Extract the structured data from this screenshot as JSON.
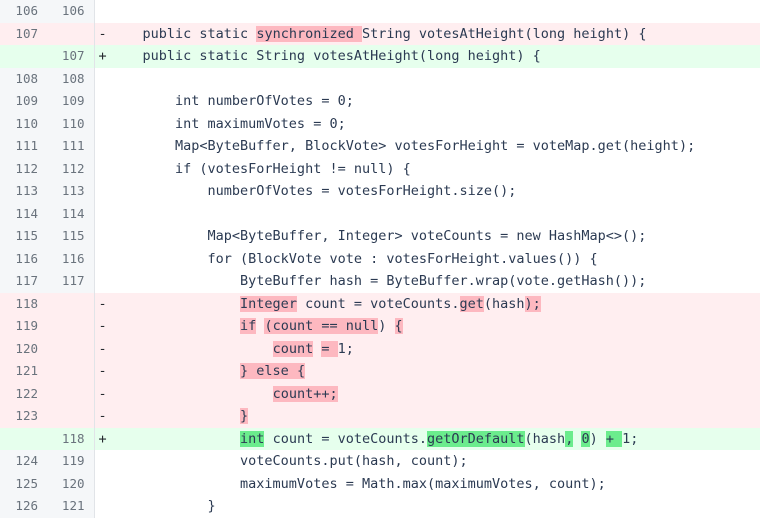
{
  "view": {
    "kind": "unified-code-diff",
    "language": "java",
    "colors": {
      "page_background": "#ffffff",
      "gutter_background": "#f5f7f9",
      "gutter_border": "#e1e4e8",
      "line_number_text": "#6a737d",
      "code_text": "#2b3a52",
      "deletion_line_background": "#ffeef0",
      "insertion_line_background": "#e6ffed",
      "deletion_word_highlight": "#fdb8c0",
      "insertion_word_highlight": "#6bec8d"
    },
    "markers": {
      "deletion": "-",
      "insertion": "+",
      "context": ""
    }
  },
  "rows": [
    {
      "type": "context",
      "old_line": "106",
      "new_line": "106",
      "marker": "",
      "segments": [
        {
          "text": "",
          "highlight": false
        }
      ]
    },
    {
      "type": "deletion",
      "old_line": "107",
      "new_line": "",
      "marker": "-",
      "segments": [
        {
          "text": "    public static ",
          "highlight": false
        },
        {
          "text": "synchronized ",
          "highlight": true
        },
        {
          "text": "String votesAtHeight(long height) {",
          "highlight": false
        }
      ]
    },
    {
      "type": "insertion",
      "old_line": "",
      "new_line": "107",
      "marker": "+",
      "segments": [
        {
          "text": "    public static String votesAtHeight(long height) {",
          "highlight": false
        }
      ]
    },
    {
      "type": "context",
      "old_line": "108",
      "new_line": "108",
      "marker": "",
      "segments": [
        {
          "text": "",
          "highlight": false
        }
      ]
    },
    {
      "type": "context",
      "old_line": "109",
      "new_line": "109",
      "marker": "",
      "segments": [
        {
          "text": "        int numberOfVotes = 0;",
          "highlight": false
        }
      ]
    },
    {
      "type": "context",
      "old_line": "110",
      "new_line": "110",
      "marker": "",
      "segments": [
        {
          "text": "        int maximumVotes = 0;",
          "highlight": false
        }
      ]
    },
    {
      "type": "context",
      "old_line": "111",
      "new_line": "111",
      "marker": "",
      "segments": [
        {
          "text": "        Map<ByteBuffer, BlockVote> votesForHeight = voteMap.get(height);",
          "highlight": false
        }
      ]
    },
    {
      "type": "context",
      "old_line": "112",
      "new_line": "112",
      "marker": "",
      "segments": [
        {
          "text": "        if (votesForHeight != null) {",
          "highlight": false
        }
      ]
    },
    {
      "type": "context",
      "old_line": "113",
      "new_line": "113",
      "marker": "",
      "segments": [
        {
          "text": "            numberOfVotes = votesForHeight.size();",
          "highlight": false
        }
      ]
    },
    {
      "type": "context",
      "old_line": "114",
      "new_line": "114",
      "marker": "",
      "segments": [
        {
          "text": "",
          "highlight": false
        }
      ]
    },
    {
      "type": "context",
      "old_line": "115",
      "new_line": "115",
      "marker": "",
      "segments": [
        {
          "text": "            Map<ByteBuffer, Integer> voteCounts = new HashMap<>();",
          "highlight": false
        }
      ]
    },
    {
      "type": "context",
      "old_line": "116",
      "new_line": "116",
      "marker": "",
      "segments": [
        {
          "text": "            for (BlockVote vote : votesForHeight.values()) {",
          "highlight": false
        }
      ]
    },
    {
      "type": "context",
      "old_line": "117",
      "new_line": "117",
      "marker": "",
      "segments": [
        {
          "text": "                ByteBuffer hash = ByteBuffer.wrap(vote.getHash());",
          "highlight": false
        }
      ]
    },
    {
      "type": "deletion",
      "old_line": "118",
      "new_line": "",
      "marker": "-",
      "segments": [
        {
          "text": "                ",
          "highlight": false
        },
        {
          "text": "Integer",
          "highlight": true
        },
        {
          "text": " count = voteCounts.",
          "highlight": false
        },
        {
          "text": "get",
          "highlight": true
        },
        {
          "text": "(hash",
          "highlight": false
        },
        {
          "text": ");",
          "highlight": true
        }
      ]
    },
    {
      "type": "deletion",
      "old_line": "119",
      "new_line": "",
      "marker": "-",
      "segments": [
        {
          "text": "                ",
          "highlight": false
        },
        {
          "text": "if",
          "highlight": true
        },
        {
          "text": " ",
          "highlight": false
        },
        {
          "text": "(count == null",
          "highlight": true
        },
        {
          "text": ") ",
          "highlight": false
        },
        {
          "text": "{",
          "highlight": true
        }
      ]
    },
    {
      "type": "deletion",
      "old_line": "120",
      "new_line": "",
      "marker": "-",
      "segments": [
        {
          "text": "                    ",
          "highlight": false
        },
        {
          "text": "count",
          "highlight": true
        },
        {
          "text": " ",
          "highlight": false
        },
        {
          "text": "= ",
          "highlight": true
        },
        {
          "text": "1;",
          "highlight": false
        }
      ]
    },
    {
      "type": "deletion",
      "old_line": "121",
      "new_line": "",
      "marker": "-",
      "segments": [
        {
          "text": "                ",
          "highlight": false
        },
        {
          "text": "} else {",
          "highlight": true
        }
      ]
    },
    {
      "type": "deletion",
      "old_line": "122",
      "new_line": "",
      "marker": "-",
      "segments": [
        {
          "text": "                    ",
          "highlight": false
        },
        {
          "text": "count++;",
          "highlight": true
        }
      ]
    },
    {
      "type": "deletion",
      "old_line": "123",
      "new_line": "",
      "marker": "-",
      "segments": [
        {
          "text": "                ",
          "highlight": false
        },
        {
          "text": "}",
          "highlight": true
        }
      ]
    },
    {
      "type": "insertion",
      "old_line": "",
      "new_line": "118",
      "marker": "+",
      "segments": [
        {
          "text": "                ",
          "highlight": false
        },
        {
          "text": "int",
          "highlight": true
        },
        {
          "text": " count = voteCounts.",
          "highlight": false
        },
        {
          "text": "getOrDefault",
          "highlight": true
        },
        {
          "text": "(hash",
          "highlight": false
        },
        {
          "text": ",",
          "highlight": true
        },
        {
          "text": " ",
          "highlight": false
        },
        {
          "text": "0",
          "highlight": true
        },
        {
          "text": ") ",
          "highlight": false
        },
        {
          "text": "+ ",
          "highlight": true
        },
        {
          "text": "1;",
          "highlight": false
        }
      ]
    },
    {
      "type": "context",
      "old_line": "124",
      "new_line": "119",
      "marker": "",
      "segments": [
        {
          "text": "                voteCounts.put(hash, count);",
          "highlight": false
        }
      ]
    },
    {
      "type": "context",
      "old_line": "125",
      "new_line": "120",
      "marker": "",
      "segments": [
        {
          "text": "                maximumVotes = Math.max(maximumVotes, count);",
          "highlight": false
        }
      ]
    },
    {
      "type": "context",
      "old_line": "126",
      "new_line": "121",
      "marker": "",
      "segments": [
        {
          "text": "            }",
          "highlight": false
        }
      ]
    }
  ]
}
